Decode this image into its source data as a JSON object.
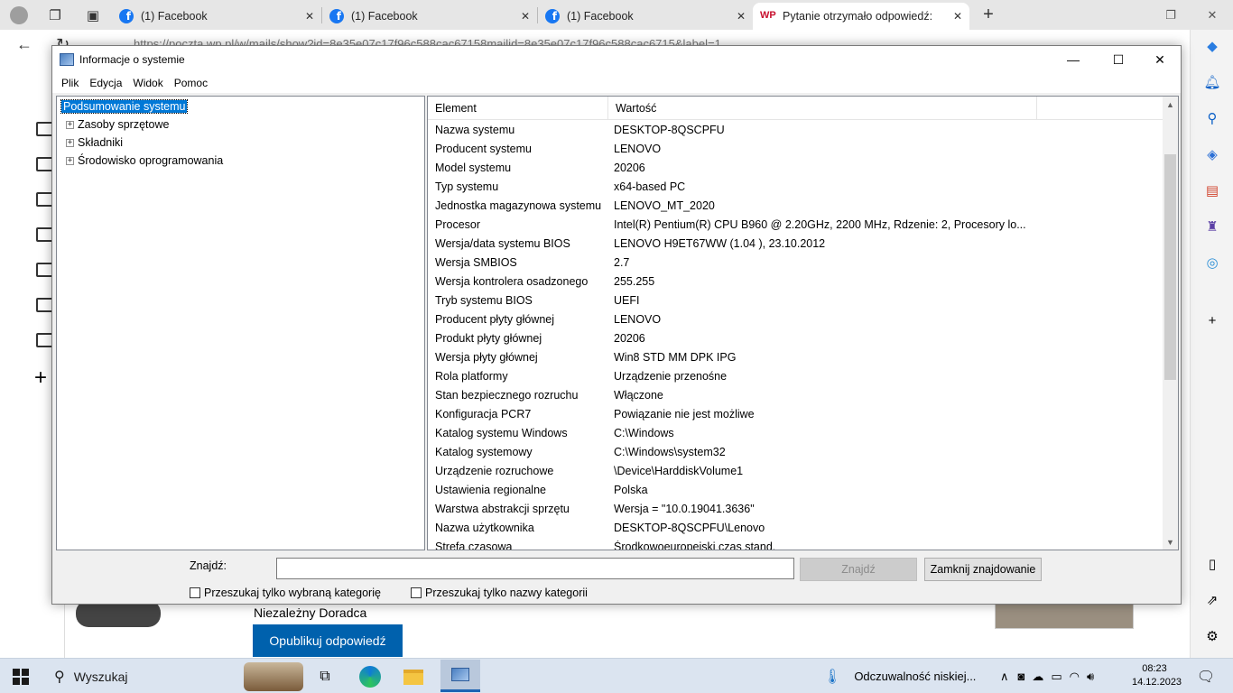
{
  "browser": {
    "tabs": [
      {
        "label": "(1) Facebook",
        "active": false
      },
      {
        "label": "(1) Facebook",
        "active": false
      },
      {
        "label": "(1) Facebook",
        "active": false
      },
      {
        "label": "Pytanie otrzymało odpowiedź: St",
        "active": true
      }
    ],
    "url": "https://poczta.wp.pl/w/mails/show?id=8e35e07c17f96c588cac67158mailid=8e35e07c17f96c588cac6715&label=1"
  },
  "window": {
    "title": "Informacje o systemie",
    "menu": [
      "Plik",
      "Edycja",
      "Widok",
      "Pomoc"
    ],
    "tree": [
      {
        "label": "Podsumowanie systemu",
        "selected": true,
        "expander": false
      },
      {
        "label": "Zasoby sprzętowe",
        "selected": false,
        "expander": true
      },
      {
        "label": "Składniki",
        "selected": false,
        "expander": true
      },
      {
        "label": "Środowisko oprogramowania",
        "selected": false,
        "expander": true
      }
    ],
    "columns": [
      "Element",
      "Wartość"
    ],
    "rows": [
      [
        "Nazwa systemu",
        "DESKTOP-8QSCPFU"
      ],
      [
        "Producent systemu",
        "LENOVO"
      ],
      [
        "Model systemu",
        "20206"
      ],
      [
        "Typ systemu",
        "x64-based PC"
      ],
      [
        "Jednostka magazynowa systemu",
        "LENOVO_MT_2020"
      ],
      [
        "Procesor",
        "Intel(R) Pentium(R) CPU B960 @ 2.20GHz, 2200 MHz, Rdzenie: 2, Procesory lo..."
      ],
      [
        "Wersja/data systemu BIOS",
        "LENOVO H9ET67WW (1.04 ), 23.10.2012"
      ],
      [
        "Wersja SMBIOS",
        "2.7"
      ],
      [
        "Wersja kontrolera osadzonego",
        "255.255"
      ],
      [
        "Tryb systemu BIOS",
        "UEFI"
      ],
      [
        "Producent płyty głównej",
        "LENOVO"
      ],
      [
        "Produkt płyty głównej",
        "20206"
      ],
      [
        "Wersja płyty głównej",
        "Win8 STD MM DPK IPG"
      ],
      [
        "Rola platformy",
        "Urządzenie przenośne"
      ],
      [
        "Stan bezpiecznego rozruchu",
        "Włączone"
      ],
      [
        "Konfiguracja PCR7",
        "Powiązanie nie jest możliwe"
      ],
      [
        "Katalog systemu Windows",
        "C:\\Windows"
      ],
      [
        "Katalog systemowy",
        "C:\\Windows\\system32"
      ],
      [
        "Urządzenie rozruchowe",
        "\\Device\\HarddiskVolume1"
      ],
      [
        "Ustawienia regionalne",
        "Polska"
      ],
      [
        "Warstwa abstrakcji sprzętu",
        "Wersja = \"10.0.19041.3636\""
      ],
      [
        "Nazwa użytkownika",
        "DESKTOP-8QSCPFU\\Lenovo"
      ],
      [
        "Strefa czasowa",
        "Środkowoeuropejski czas stand."
      ]
    ],
    "find": {
      "label": "Znajdź:",
      "value": "",
      "find_button": "Znajdź",
      "close_button": "Zamknij znajdowanie",
      "check_selected": "Przeszukaj tylko wybraną kategorię",
      "check_names": "Przeszukaj tylko nazwy kategorii"
    }
  },
  "page": {
    "advisor": "Niezależny Doradca",
    "publish": "Opublikuj odpowiedź"
  },
  "taskbar": {
    "search_placeholder": "Wyszukaj",
    "weather": "Odczuwalność niskiej...",
    "time": "08:23",
    "date": "14.12.2023"
  }
}
